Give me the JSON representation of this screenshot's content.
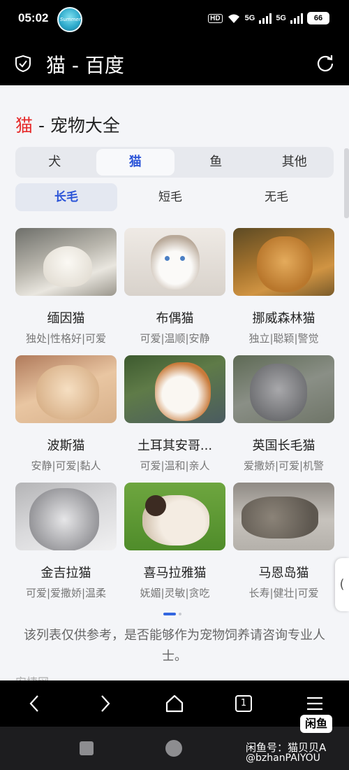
{
  "status": {
    "time": "05:02",
    "hd": "HD",
    "net1": "5G",
    "net2": "5G",
    "battery": "66"
  },
  "nav": {
    "title": "猫 - 百度"
  },
  "card": {
    "title_red": "猫",
    "title_rest": " - 宠物大全",
    "tabs": [
      "犬",
      "猫",
      "鱼",
      "其他"
    ],
    "subtabs": [
      "长毛",
      "短毛",
      "无毛"
    ],
    "breeds": [
      {
        "name": "缅因猫",
        "tags": "独处|性格好|可爱"
      },
      {
        "name": "布偶猫",
        "tags": "可爱|温顺|安静"
      },
      {
        "name": "挪威森林猫",
        "tags": "独立|聪颖|警觉"
      },
      {
        "name": "波斯猫",
        "tags": "安静|可爱|黏人"
      },
      {
        "name": "土耳其安哥...",
        "tags": "可爱|温和|亲人"
      },
      {
        "name": "英国长毛猫",
        "tags": "爱撒娇|可爱|机警"
      },
      {
        "name": "金吉拉猫",
        "tags": "可爱|爱撒娇|温柔"
      },
      {
        "name": "喜马拉雅猫",
        "tags": "妩媚|灵敏|贪吃"
      },
      {
        "name": "马恩岛猫",
        "tags": "长寿|健壮|可爱"
      }
    ],
    "disclaimer": "该列表仅供参考，是否能够作为宠物饲养请咨询专业人士。",
    "source_peek": "安捷网"
  },
  "side_handle": "(",
  "browser_bar": {
    "tabs_count": "1"
  },
  "watermark": {
    "logo": "闲鱼",
    "line1": "闲鱼号：猫贝贝A",
    "line2": "@bzhanPAIYOU"
  }
}
